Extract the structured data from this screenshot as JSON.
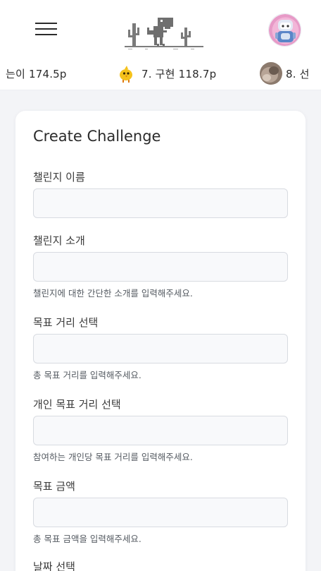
{
  "header": {
    "menu_icon": "hamburger-menu-icon",
    "logo_icon": "dino-cactus-logo",
    "avatar_icon": "user-avatar"
  },
  "ranking": {
    "items": [
      {
        "text": "는이 174.5p",
        "icon": null
      },
      {
        "text": "7. 구현 118.7p",
        "icon": "yellow-bird-avatar"
      },
      {
        "text": "8. 선",
        "icon": "cat-photo-avatar"
      }
    ]
  },
  "form": {
    "title": "Create Challenge",
    "fields": [
      {
        "label": "챌린지 이름",
        "value": "",
        "help": ""
      },
      {
        "label": "챌린지 소개",
        "value": "",
        "help": "챌린지에 대한 간단한 소개를 입력해주세요."
      },
      {
        "label": "목표 거리 선택",
        "value": "",
        "help": "총 목표 거리를 입력해주세요."
      },
      {
        "label": "개인 목표 거리 선택",
        "value": "",
        "help": "참여하는 개인당 목표 거리를 입력해주세요."
      },
      {
        "label": "목표 금액",
        "value": "",
        "help": "총 목표 금액을 입력해주세요."
      },
      {
        "label": "날짜 선택",
        "value": "",
        "help": ""
      }
    ]
  }
}
